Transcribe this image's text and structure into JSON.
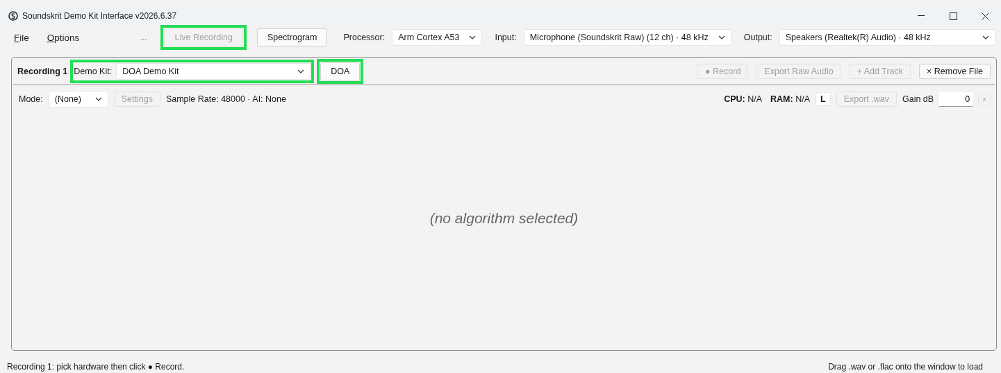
{
  "window": {
    "title": "Soundskrit Demo Kit Interface v2026.6.37"
  },
  "menu": [
    {
      "label": "File"
    },
    {
      "label": "Options"
    }
  ],
  "toolbar": {
    "overflow": "...",
    "buttons": [
      {
        "label": "Live Recording",
        "disabled": true,
        "highlighted": true
      },
      {
        "label": "Spectrogram",
        "disabled": false,
        "highlighted": false
      }
    ],
    "selectors": [
      {
        "label": "Processor:",
        "value": "Arm Cortex A53"
      },
      {
        "label": "Input:",
        "value": "Microphone (Soundskrit Raw)  (12 ch) · 48 kHz"
      },
      {
        "label": "Output:",
        "value": "Speakers (Realtek(R) Audio) · 48 kHz"
      }
    ]
  },
  "panel": {
    "tab": "Recording 1",
    "demo_kit": {
      "label": "Demo Kit:",
      "value": "DOA Demo Kit",
      "highlighted": true
    },
    "kit_button": {
      "label": "DOA",
      "highlighted": true
    },
    "actions": [
      {
        "label": "● Record",
        "disabled": true
      },
      {
        "label": "Export Raw Audio",
        "disabled": true
      },
      {
        "label": "+ Add Track",
        "disabled": true
      },
      {
        "label": "× Remove File",
        "disabled": false
      }
    ],
    "mode": {
      "label": "Mode:",
      "value": "(None)"
    },
    "settings_button": {
      "label": "Settings",
      "disabled": true
    },
    "info": "Sample Rate: 48000 · AI: None",
    "stats": [
      {
        "label": "CPU:",
        "value": "N/A"
      },
      {
        "label": "RAM:",
        "value": "N/A"
      }
    ],
    "channel_button": "L",
    "export_button": {
      "label": "Export .wav",
      "disabled": true
    },
    "gain": {
      "label": "Gain dB",
      "value": "0"
    },
    "clear_button": {
      "label": "×",
      "disabled": true
    },
    "placeholder": "(no algorithm selected)"
  },
  "status_bar": {
    "left": "Recording 1: pick hardware then click ● Record.",
    "right": "Drag .wav or .flac onto the window to load"
  }
}
